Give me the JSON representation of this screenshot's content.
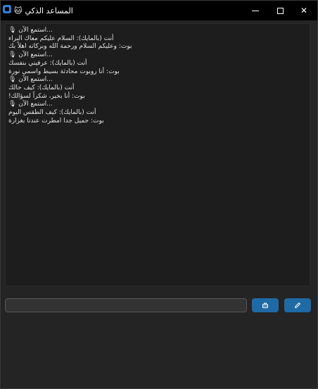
{
  "window": {
    "title": "المساعد الذكي",
    "title_emoji": "🐱",
    "accent": "#1f6aa5",
    "background": "#242424"
  },
  "controls": {
    "minimize": "minimize-icon",
    "maximize": "maximize-icon",
    "close": "close-icon",
    "close_glyph": "✕"
  },
  "chat": {
    "lines": [
      "...استمع الآن 🎙",
      "أنت (بالمايك): السلام عليكم معاك البراء",
      "بوت: وعليكم السلام ورحمة الله وبركاته اهلاً بك",
      "...استمع الآن 🎙",
      "أنت (بالمايك): عرفيني بنفسك",
      "بوت: أنا روبوت محادثة بسيط واسمي نورة",
      "...استمع الآن 🎙",
      "أنت (بالمايك): كيف حالك",
      "بوت: أنا بخير، شكراً لسؤالك!",
      "...استمع الآن 🎙",
      "أنت (بالمايك): كيف الطقس اليوم",
      "بوت: جميل جدا امطرت عندنا بغزارة"
    ]
  },
  "input": {
    "value": "",
    "placeholder": ""
  },
  "buttons": {
    "send_icon": "send-icon",
    "mic_icon": "microphone-icon"
  }
}
